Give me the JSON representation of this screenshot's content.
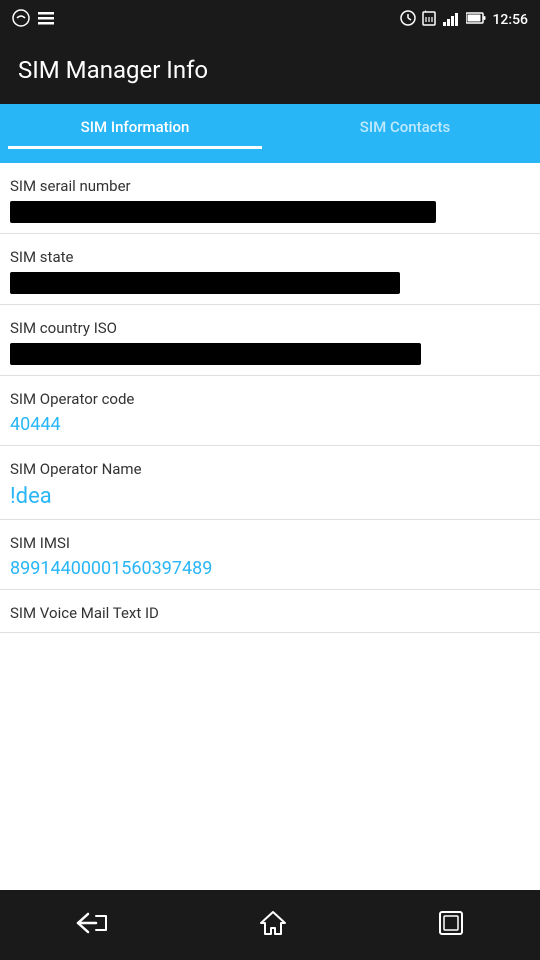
{
  "statusBar": {
    "time": "12:56",
    "icons": [
      "swiftkey",
      "menu",
      "alarm",
      "sim-signal",
      "signal-bars",
      "battery"
    ]
  },
  "header": {
    "title": "SIM Manager Info"
  },
  "tabs": [
    {
      "label": "SIM Information",
      "active": true
    },
    {
      "label": "SIM Contacts",
      "active": false
    }
  ],
  "fields": [
    {
      "label": "SIM serail number",
      "type": "hidden_bar",
      "bar_width": "82%"
    },
    {
      "label": "SIM state",
      "type": "hidden_bar",
      "bar_width": "75%"
    },
    {
      "label": "SIM country ISO",
      "type": "hidden_bar",
      "bar_width": "79%"
    },
    {
      "label": "SIM Operator code",
      "type": "text",
      "value": "40444"
    },
    {
      "label": "SIM Operator Name",
      "type": "text",
      "value": "!dea"
    },
    {
      "label": "SIM IMSI",
      "type": "text",
      "value": "89914400001560397489"
    },
    {
      "label": "SIM Voice Mail Text ID",
      "type": "partial_hidden"
    }
  ],
  "navbar": {
    "back_label": "←",
    "home_label": "⌂",
    "recents_label": "▣"
  }
}
